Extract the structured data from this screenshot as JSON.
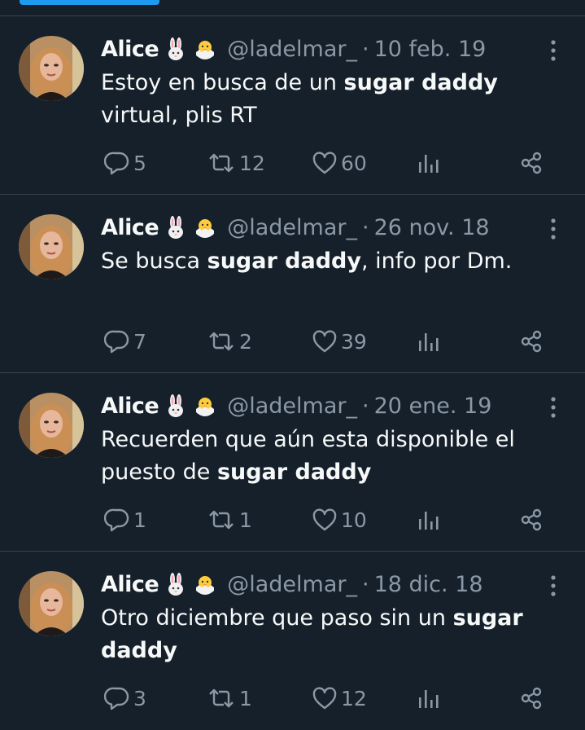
{
  "tweets": [
    {
      "name": "Alice",
      "handle": "@ladelmar_",
      "date": "10 feb. 19",
      "text_parts": [
        "Estoy en busca de un ",
        "sugar daddy",
        " virtual, plis RT"
      ],
      "replies": "5",
      "retweets": "12",
      "likes": "60"
    },
    {
      "name": "Alice",
      "handle": "@ladelmar_",
      "date": "26 nov. 18",
      "text_parts": [
        "Se busca ",
        "sugar daddy",
        ", info por Dm."
      ],
      "replies": "7",
      "retweets": "2",
      "likes": "39"
    },
    {
      "name": "Alice",
      "handle": "@ladelmar_",
      "date": "20 ene. 19",
      "text_parts": [
        "Recuerden que aún esta disponible el puesto de ",
        "sugar daddy",
        ""
      ],
      "replies": "1",
      "retweets": "1",
      "likes": "10"
    },
    {
      "name": "Alice",
      "handle": "@ladelmar_",
      "date": "18 dic. 18",
      "text_parts": [
        "Otro diciembre que paso sin un ",
        "sugar daddy",
        ""
      ],
      "replies": "3",
      "retweets": "1",
      "likes": "12"
    }
  ],
  "separator": "·",
  "emoji_icons": [
    "rabbit-emoji-icon",
    "hatching-chick-emoji-icon"
  ],
  "colors": {
    "background": "#15202b",
    "text": "#f7f9f9",
    "muted": "#8b98a5",
    "border": "#38444d",
    "accent": "#1d9bf0"
  }
}
